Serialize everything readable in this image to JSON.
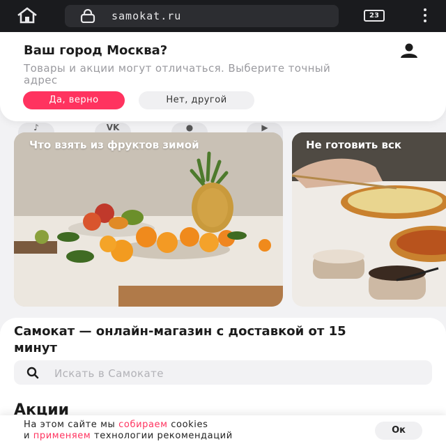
{
  "browser": {
    "url": "samokat.ru",
    "tab_count": "23"
  },
  "city_prompt": {
    "title": "Ваш город Москва?",
    "subtitle": "Товары и акции могут отличаться. Выберите точный адрес",
    "confirm_label": "Да, верно",
    "other_label": "Нет, другой"
  },
  "social_icons": [
    "tiktok-icon",
    "vk-icon",
    "ok-icon",
    "youtube-icon"
  ],
  "stories": [
    {
      "title": "Что взять из фруктов зимой"
    },
    {
      "title": "Не готовить вск"
    }
  ],
  "main": {
    "headline": "Самокат — онлайн-магазин с доставкой от 15 минут",
    "search_placeholder": "Искать в Самокате",
    "section_title": "Акции"
  },
  "cookie": {
    "part1": "На этом сайте мы ",
    "link1": "собираем",
    "part2": " cookies",
    "part3": "и ",
    "link2": "применяем",
    "part4": " технологии рекомендаций",
    "ok_label": "Ок"
  },
  "colors": {
    "accent": "#ff335f",
    "chrome_bg": "#1a1b1e"
  }
}
